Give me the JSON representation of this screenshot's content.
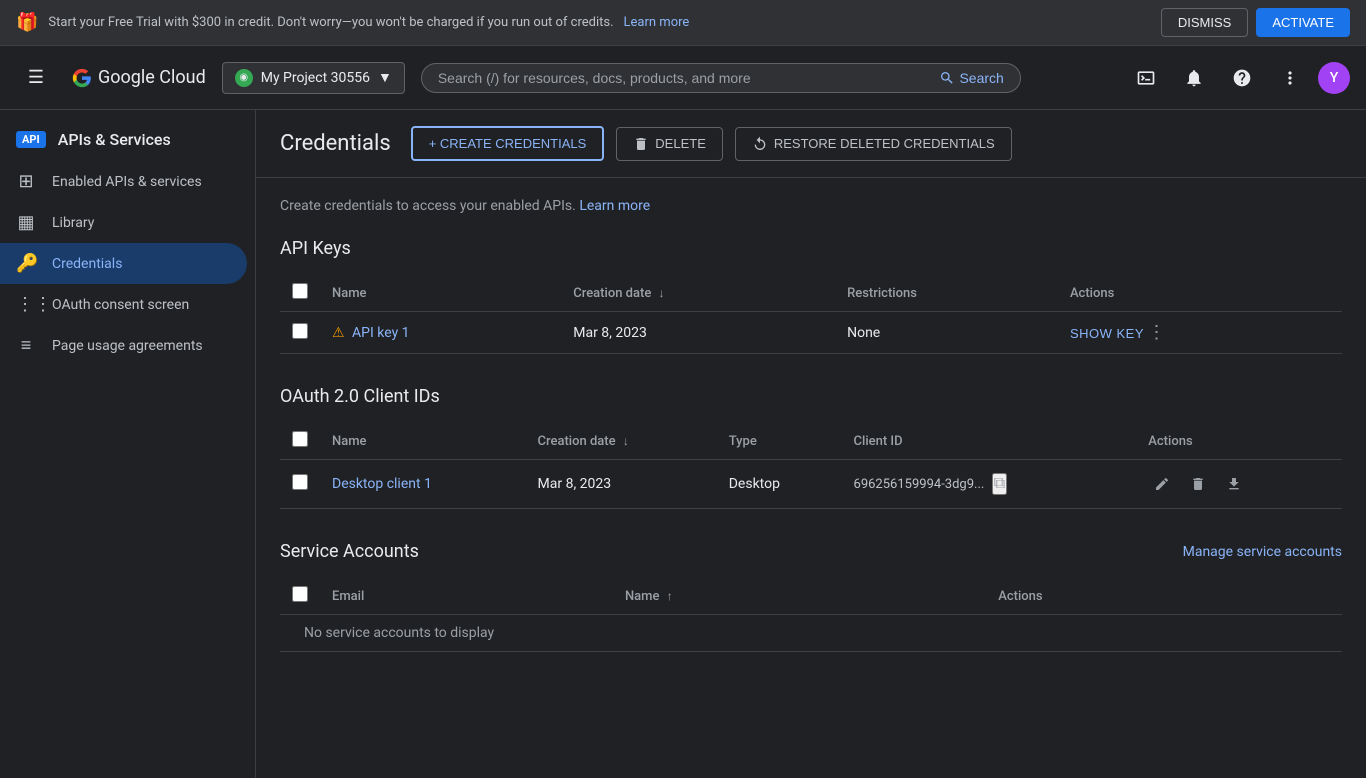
{
  "banner": {
    "text": "Start your Free Trial with $300 in credit. Don't worry—you won't be charged if you run out of credits.",
    "link_text": "Learn more",
    "dismiss_label": "DISMISS",
    "activate_label": "ACTIVATE"
  },
  "header": {
    "logo_text": "Google Cloud",
    "project_name": "My Project 30556",
    "search_placeholder": "Search (/) for resources, docs, products, and more",
    "search_label": "Search",
    "avatar_letter": "Y"
  },
  "sidebar": {
    "api_badge": "API",
    "title": "APIs & Services",
    "items": [
      {
        "id": "enabled",
        "label": "Enabled APIs & services",
        "icon": "⊞"
      },
      {
        "id": "library",
        "label": "Library",
        "icon": "▦"
      },
      {
        "id": "credentials",
        "label": "Credentials",
        "icon": "🔑",
        "active": true
      },
      {
        "id": "oauth",
        "label": "OAuth consent screen",
        "icon": "⋮⋮"
      },
      {
        "id": "usage",
        "label": "Page usage agreements",
        "icon": "≡"
      }
    ]
  },
  "main": {
    "page_title": "Credentials",
    "create_label": "+ CREATE CREDENTIALS",
    "delete_label": "DELETE",
    "restore_label": "RESTORE DELETED CREDENTIALS",
    "info_text": "Create credentials to access your enabled APIs.",
    "info_link": "Learn more",
    "api_keys": {
      "section_title": "API Keys",
      "columns": [
        "Name",
        "Creation date",
        "Restrictions",
        "Actions"
      ],
      "rows": [
        {
          "name": "API key 1",
          "creation_date": "Mar 8, 2023",
          "restrictions": "None",
          "has_warning": true
        }
      ]
    },
    "oauth": {
      "section_title": "OAuth 2.0 Client IDs",
      "columns": [
        "Name",
        "Creation date",
        "Type",
        "Client ID",
        "Actions"
      ],
      "rows": [
        {
          "name": "Desktop client 1",
          "creation_date": "Mar 8, 2023",
          "type": "Desktop",
          "client_id": "696256159994-3dg9..."
        }
      ]
    },
    "service_accounts": {
      "section_title": "Service Accounts",
      "manage_label": "Manage service accounts",
      "columns": [
        "Email",
        "Name",
        "Actions"
      ],
      "empty_text": "No service accounts to display"
    }
  }
}
